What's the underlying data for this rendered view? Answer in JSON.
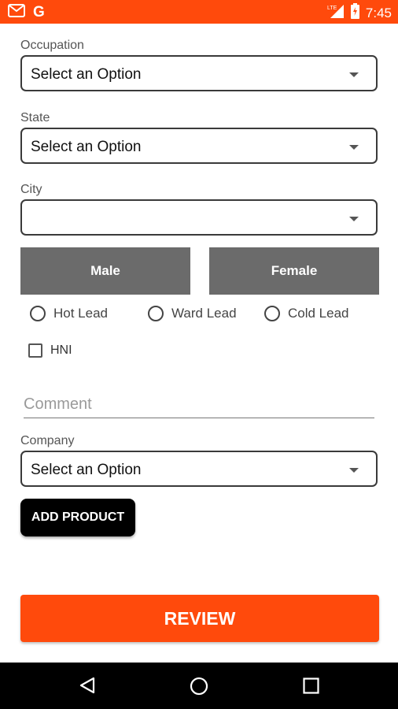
{
  "colors": {
    "accent": "#FF4A0C",
    "button_gray": "#6B6B6B",
    "dark": "#000000"
  },
  "status_bar": {
    "time": "7:45",
    "network": "LTE",
    "icons": [
      "gmail-icon",
      "google-icon",
      "signal-icon",
      "battery-icon"
    ]
  },
  "form": {
    "occupation": {
      "label": "Occupation",
      "value": "Select an Option"
    },
    "state": {
      "label": "State",
      "value": "Select an Option"
    },
    "city": {
      "label": "City",
      "value": ""
    },
    "gender": {
      "male_label": "Male",
      "female_label": "Female"
    },
    "lead_types": [
      "Hot Lead",
      "Ward Lead",
      "Cold Lead"
    ],
    "hni_label": "HNI",
    "comment_placeholder": "Comment",
    "company": {
      "label": "Company",
      "value": "Select an Option"
    },
    "add_product_label": "ADD PRODUCT",
    "review_label": "REVIEW"
  },
  "navbar": {
    "icons": [
      "back-icon",
      "home-icon",
      "recents-icon"
    ]
  }
}
